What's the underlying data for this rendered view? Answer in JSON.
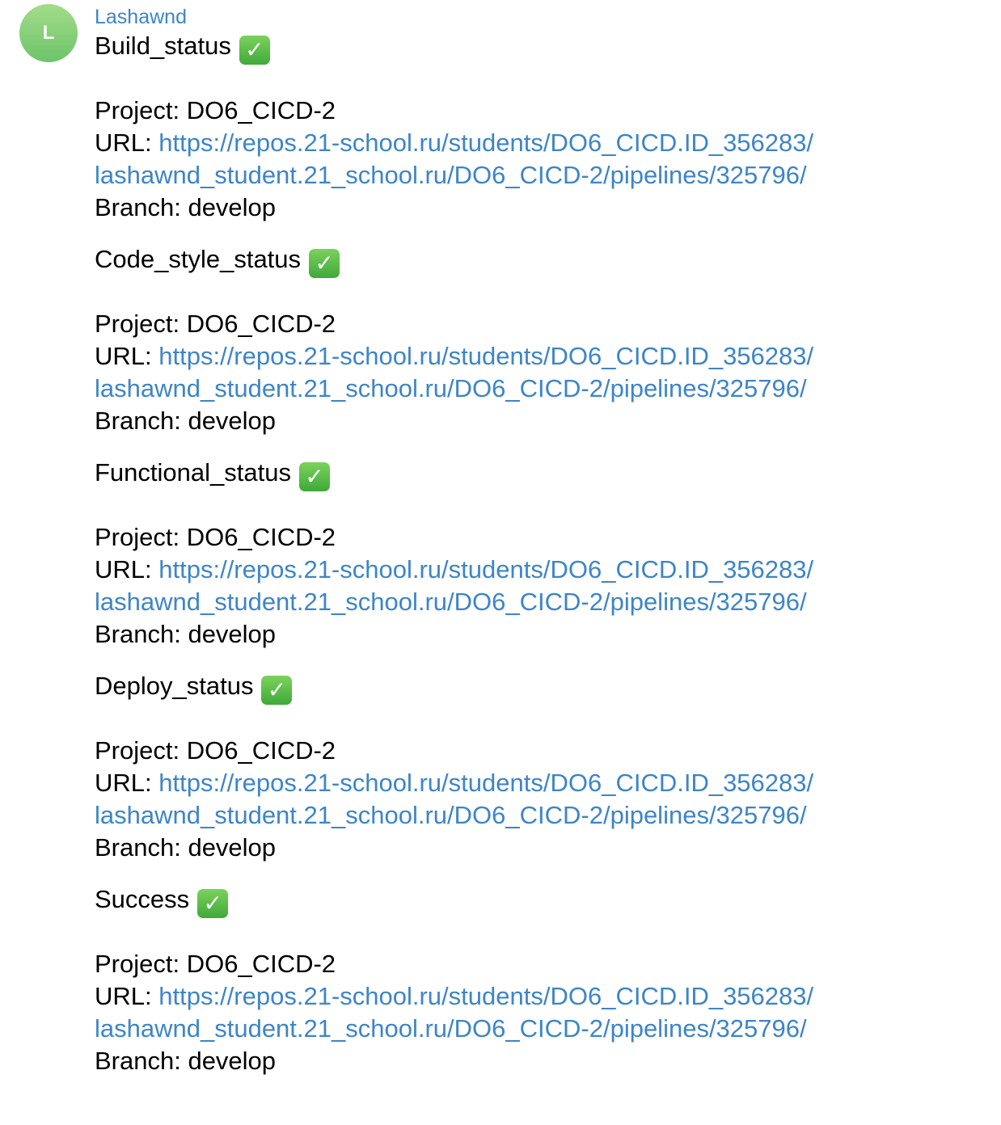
{
  "sender": {
    "name": "Lashawnd",
    "avatar_letter": "L",
    "avatar_color": "#7dcc6c",
    "name_color": "#3d85c8"
  },
  "messages": [
    {
      "title": "Build_status",
      "check_icon": "white-check-mark-icon",
      "project_label": "Project: DO6_CICD-2",
      "url_prefix": "URL: ",
      "url_line1": "https://repos.21-school.ru/students/DO6_CICD.ID_356283/",
      "url_line2": "lashawnd_student.21_school.ru/DO6_CICD-2/pipelines/325796/",
      "branch_label": "Branch: develop"
    },
    {
      "title": "Code_style_status",
      "check_icon": "white-check-mark-icon",
      "project_label": "Project: DO6_CICD-2",
      "url_prefix": "URL: ",
      "url_line1": "https://repos.21-school.ru/students/DO6_CICD.ID_356283/",
      "url_line2": "lashawnd_student.21_school.ru/DO6_CICD-2/pipelines/325796/",
      "branch_label": "Branch: develop"
    },
    {
      "title": "Functional_status",
      "check_icon": "white-check-mark-icon",
      "project_label": "Project: DO6_CICD-2",
      "url_prefix": "URL: ",
      "url_line1": "https://repos.21-school.ru/students/DO6_CICD.ID_356283/",
      "url_line2": "lashawnd_student.21_school.ru/DO6_CICD-2/pipelines/325796/",
      "branch_label": "Branch: develop"
    },
    {
      "title": "Deploy_status",
      "check_icon": "white-check-mark-icon",
      "project_label": "Project: DO6_CICD-2",
      "url_prefix": "URL: ",
      "url_line1": "https://repos.21-school.ru/students/DO6_CICD.ID_356283/",
      "url_line2": "lashawnd_student.21_school.ru/DO6_CICD-2/pipelines/325796/",
      "branch_label": "Branch: develop"
    },
    {
      "title": "Success",
      "check_icon": "white-check-mark-icon",
      "project_label": "Project: DO6_CICD-2",
      "url_prefix": "URL: ",
      "url_line1": "https://repos.21-school.ru/students/DO6_CICD.ID_356283/",
      "url_line2": "lashawnd_student.21_school.ru/DO6_CICD-2/pipelines/325796/",
      "branch_label": "Branch: develop"
    }
  ]
}
